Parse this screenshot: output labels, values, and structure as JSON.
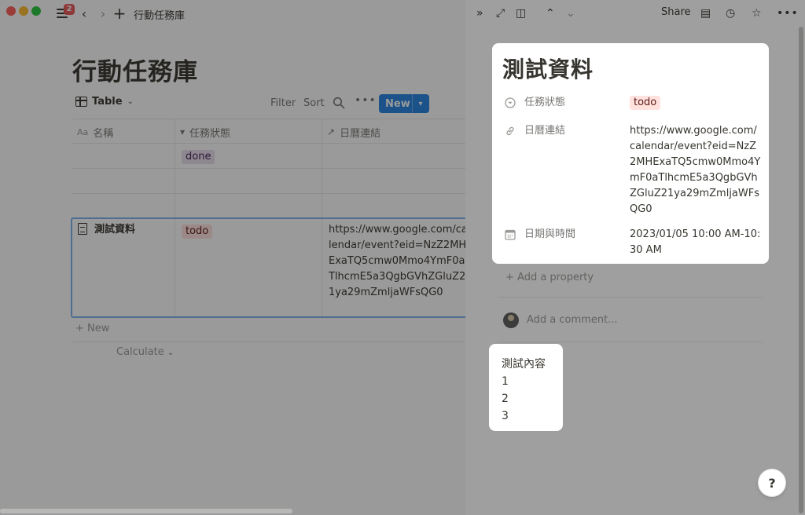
{
  "topbar": {
    "notification_count": "2",
    "breadcrumb": "行動任務庫"
  },
  "database": {
    "title": "行動任務庫",
    "view_name": "Table",
    "filter_label": "Filter",
    "sort_label": "Sort",
    "new_label": "New",
    "columns": [
      "名稱",
      "任務狀態",
      "日曆連結"
    ],
    "rows": [
      {
        "name": "",
        "status": "done",
        "link": ""
      },
      {
        "name": "",
        "status": "",
        "link": ""
      },
      {
        "name": "",
        "status": "",
        "link": ""
      },
      {
        "name": "測試資料",
        "status": "todo",
        "link": "https://www.google.com/calendar/event?eid=NzZ2MHExaTQ5cmw0Mmo4YmF0aTlhcmE5a3QgbGVhZGluZ21ya29mZmljaWFsQG0"
      }
    ],
    "add_new_label": "New",
    "calculate_label": "Calculate"
  },
  "peek": {
    "share_label": "Share",
    "page_title": "測試資料",
    "properties": [
      {
        "name": "任務狀態",
        "value": "todo"
      },
      {
        "name": "日曆連結",
        "value": "https://www.google.com/calendar/event?eid=NzZ2MHExaTQ5cmw0Mmo4YmF0aTlhcmE5a3QgbGVhZGluZ21ya29mZmljaWFsQG0"
      },
      {
        "name": "日期與時間",
        "value": "2023/01/05 10:00 AM-10:30 AM"
      }
    ],
    "add_property_label": "Add a property",
    "comment_placeholder": "Add a comment...",
    "body_lines": [
      "測試內容",
      "1",
      "2",
      "3"
    ],
    "help_label": "?"
  }
}
